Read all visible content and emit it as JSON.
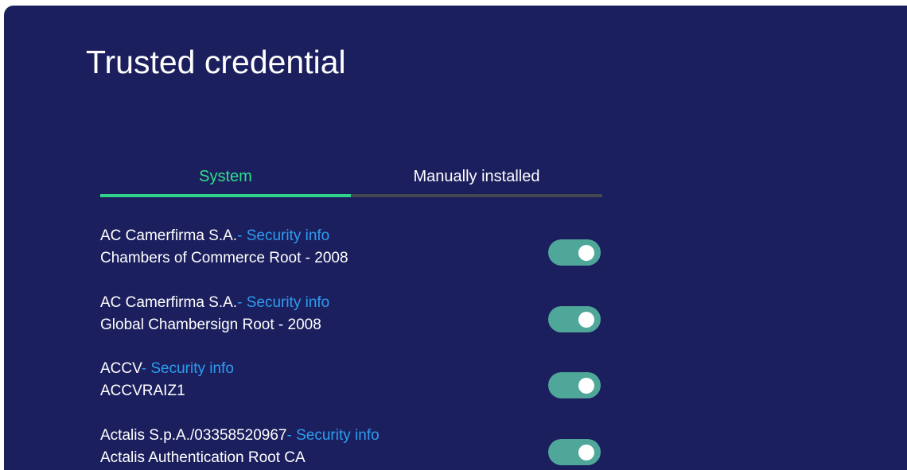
{
  "page": {
    "title": "Trusted credential"
  },
  "tabs": [
    {
      "label": "System",
      "active": true
    },
    {
      "label": "Manually installed",
      "active": false
    }
  ],
  "colors": {
    "background": "#1c1f5e",
    "active_tab": "#2fe08a",
    "link": "#2e9cf0",
    "toggle_on": "#4fa79a"
  },
  "certificates": [
    {
      "org": "AC Camerfirma S.A.",
      "link": "- Security info",
      "name": "Chambers of Commerce Root - 2008",
      "enabled": true
    },
    {
      "org": "AC Camerfirma S.A.",
      "link": "- Security info",
      "name": "Global Chambersign Root - 2008",
      "enabled": true
    },
    {
      "org": "ACCV",
      "link": "- Security info",
      "name": "ACCVRAIZ1",
      "enabled": true
    },
    {
      "org": "Actalis S.p.A./03358520967",
      "link": "- Security info",
      "name": "Actalis Authentication Root CA",
      "enabled": true
    }
  ]
}
